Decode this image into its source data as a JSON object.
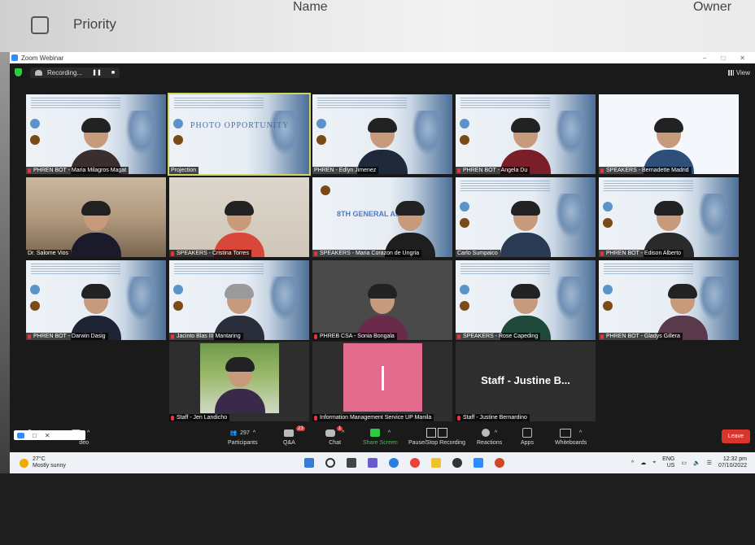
{
  "background": {
    "priority_label": "Priority",
    "name_header": "Name",
    "owner_header": "Owner"
  },
  "window": {
    "title": "Zoom Webinar",
    "recording_label": "Recording...",
    "view_label": "View"
  },
  "tiles": [
    {
      "name": "PHREN BOT - Maria Milagros Magat"
    },
    {
      "name": "Projection",
      "slide_text": "PHOTO OPPORTUNITY"
    },
    {
      "name": "PHREN - Edlyn Jimenez"
    },
    {
      "name": "PHREN BOT - Angela Du"
    },
    {
      "name": "SPEAKERS - Bernadette Madrid"
    },
    {
      "name": "Dr. Salome Vios"
    },
    {
      "name": "SPEAKERS - Cristina Torres"
    },
    {
      "name": "SPEAKERS - Maria Corazon de Ungria",
      "slide_text": "8TH GENERAL ASS"
    },
    {
      "name": "Carlo Sumpaico"
    },
    {
      "name": "PHREN BOT - Edison Alberto"
    },
    {
      "name": "PHREN BOT - Darwin Dasig"
    },
    {
      "name": "Jacinto Blas III Mantaring"
    },
    {
      "name": "PHREB CSA - Sonia Bongala"
    },
    {
      "name": "SPEAKERS - Rose Capeding"
    },
    {
      "name": "PHREN BOT - Gladys Gillera"
    },
    {
      "name": "Staff - Jen Landicho"
    },
    {
      "name": "Information Management Service UP Manila"
    },
    {
      "name": "Staff - Justine Bernardino",
      "big_name": "Staff - Justine B..."
    }
  ],
  "toolbar": {
    "video_label": "deo",
    "participants_label": "Participants",
    "participants_count": "297",
    "qa_label": "Q&A",
    "qa_badge": "23",
    "chat_label": "Chat",
    "chat_badge": "1",
    "share_label": "Share Screen",
    "pause_label": "Pause/Stop Recording",
    "reactions_label": "Reactions",
    "apps_label": "Apps",
    "whiteboards_label": "Whiteboards",
    "leave_label": "Leave"
  },
  "taskbar": {
    "temperature": "27°C",
    "weather": "Mostly sunny",
    "lang1": "ENG",
    "lang2": "US",
    "time": "12:32 pm",
    "date": "07/10/2022"
  },
  "colors": {
    "leave": "#d9352c",
    "share": "#2ecc40",
    "badge": "#e03e3e",
    "zoom_blue": "#2d8cff"
  }
}
